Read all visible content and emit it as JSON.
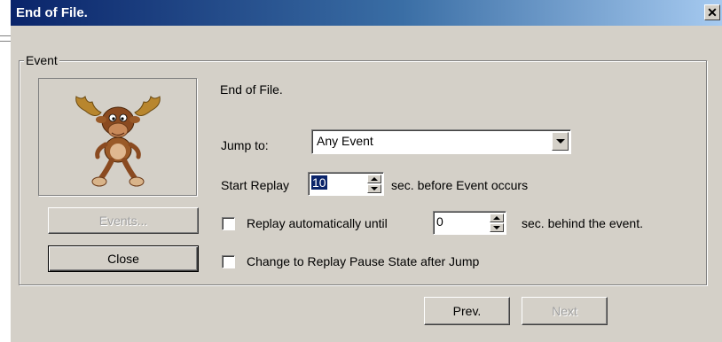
{
  "window": {
    "title": "End of File.",
    "close_glyph": "✕"
  },
  "group": {
    "legend": "Event"
  },
  "event": {
    "description": "End of File.",
    "mascot_icon": "moose-mascot-icon"
  },
  "jump": {
    "label": "Jump to:",
    "selected": "Any Event"
  },
  "start_replay": {
    "label": "Start Replay",
    "value": "10",
    "suffix": "sec. before Event occurs"
  },
  "auto_replay": {
    "label": "Replay automatically until",
    "checked": false,
    "value": "0",
    "suffix": "sec. behind the event."
  },
  "pause_state": {
    "label": "Change to Replay Pause State after Jump",
    "checked": false
  },
  "buttons": {
    "events": "Events...",
    "close": "Close",
    "prev": "Prev.",
    "next": "Next"
  },
  "colors": {
    "face": "#d4d0c8",
    "title_start": "#0a246a",
    "title_end": "#a6caf0",
    "disabled_text": "#a0a0a0"
  }
}
